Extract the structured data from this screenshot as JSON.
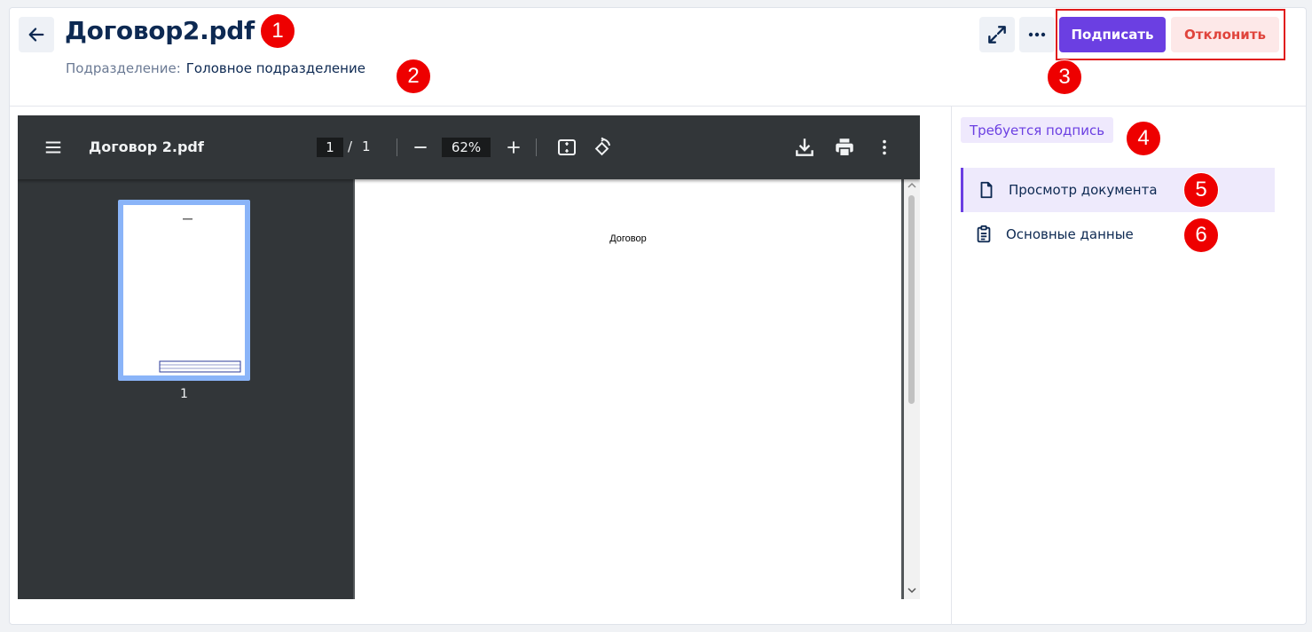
{
  "header": {
    "title": "Договор2.pdf",
    "subdivision_label": "Подразделение:",
    "subdivision_value": "Головное подразделение",
    "sign_label": "Подписать",
    "reject_label": "Отклонить",
    "icons": [
      "arrow-left-icon",
      "expand-icon",
      "more-horizontal-icon"
    ]
  },
  "viewer": {
    "file_name": "Договор 2.pdf",
    "current_page": "1",
    "page_separator": "/",
    "total_pages": "1",
    "zoom": "62%",
    "thumbnail_number": "1",
    "page_heading": "Договор",
    "icons": [
      "menu-icon",
      "zoom-out-icon",
      "zoom-in-icon",
      "fit-page-icon",
      "rotate-icon",
      "download-icon",
      "print-icon",
      "more-vertical-icon"
    ]
  },
  "sidebar": {
    "status": "Требуется подпись",
    "items": [
      {
        "label": "Просмотр документа",
        "icon": "document-icon",
        "active": true
      },
      {
        "label": "Основные данные",
        "icon": "clipboard-icon",
        "active": false
      }
    ]
  },
  "markers": [
    "1",
    "2",
    "3",
    "4",
    "5",
    "6"
  ],
  "colors": {
    "accent": "#6b3fe2",
    "danger": "#e0443c",
    "title": "#0d2952",
    "highlight": "#e01b1b"
  }
}
